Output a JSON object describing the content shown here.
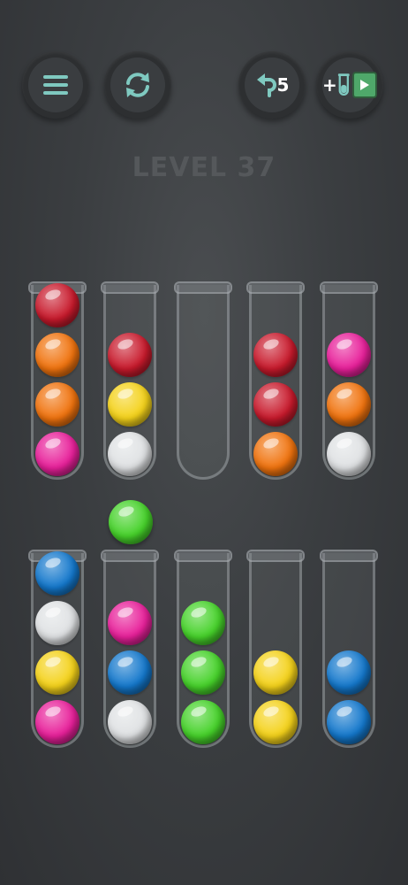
{
  "header": {
    "level_label": "LEVEL 37",
    "undo_count": "5",
    "add_tube_plus": "+"
  },
  "icons": {
    "menu": "menu-icon",
    "restart": "restart-icon",
    "undo": "undo-icon",
    "add_tube": "test-tube-icon",
    "play": "play-icon"
  },
  "colors": {
    "red": "#c81a2c",
    "orange": "#f0730e",
    "pink": "#e8209a",
    "white": "#dfe1e3",
    "yellow": "#f4d21a",
    "green": "#46d22a",
    "blue": "#1478cc"
  },
  "board": {
    "selected_ball": "green",
    "tubes_top_row": [
      {
        "balls_top_to_bottom": [
          "red",
          "orange",
          "orange",
          "pink"
        ]
      },
      {
        "balls_top_to_bottom": [
          "red",
          "yellow",
          "white"
        ]
      },
      {
        "balls_top_to_bottom": []
      },
      {
        "balls_top_to_bottom": [
          "red",
          "red",
          "orange"
        ]
      },
      {
        "balls_top_to_bottom": [
          "pink",
          "orange",
          "white"
        ]
      }
    ],
    "tubes_bottom_row": [
      {
        "balls_top_to_bottom": [
          "blue",
          "white",
          "yellow",
          "pink"
        ]
      },
      {
        "balls_top_to_bottom": [
          "pink",
          "blue",
          "white"
        ]
      },
      {
        "balls_top_to_bottom": [
          "green",
          "green",
          "green"
        ]
      },
      {
        "balls_top_to_bottom": [
          "yellow",
          "yellow"
        ]
      },
      {
        "balls_top_to_bottom": [
          "blue",
          "blue"
        ]
      }
    ]
  }
}
